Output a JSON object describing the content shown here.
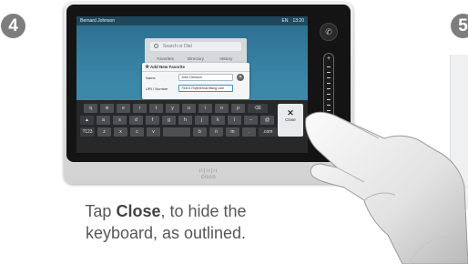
{
  "steps": {
    "current": "4",
    "next": "5"
  },
  "device": {
    "status": {
      "name": "Bernard Johnson",
      "lang": "EN",
      "time": "13:20"
    },
    "search": {
      "placeholder": "Search or Dial",
      "tabs": [
        "Favorites",
        "Directory",
        "History"
      ]
    },
    "dialog": {
      "title": "Add New Favorite",
      "fields": [
        {
          "label": "Name",
          "value": "John Dewson"
        },
        {
          "label": "URI / Number",
          "value": "7540175@bernardfang.com"
        }
      ]
    },
    "keyboard": {
      "rows": [
        [
          "q",
          "w",
          "e",
          "r",
          "t",
          "y",
          "u",
          "i",
          "o",
          "p",
          "⌫"
        ],
        [
          "▲",
          "a",
          "s",
          "d",
          "f",
          "g",
          "h",
          "j",
          "k",
          "l",
          "–",
          "@"
        ],
        [
          "?123",
          "z",
          "x",
          "c",
          "v",
          "__",
          "b",
          "n",
          "m",
          ".",
          ".com"
        ]
      ],
      "close_label": "Close",
      "close_glyph": "✕"
    },
    "brand": "cisco",
    "brand_bars": "ıı|ıı|ıı"
  },
  "caption": {
    "pre": "Tap ",
    "bold": "Close",
    "post": ", to hide the keyboard, as outlined."
  },
  "colors": {
    "badge": "#7d7d7d",
    "screen": "#3a86a8",
    "keyboard": "#26282a",
    "caption": "#575757"
  },
  "icons": [
    "search-icon",
    "star-icon",
    "clear-icon",
    "close-icon",
    "phone-icon"
  ]
}
